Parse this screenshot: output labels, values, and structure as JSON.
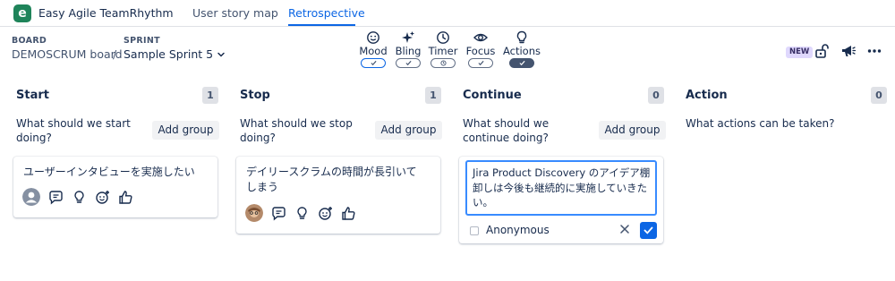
{
  "app": {
    "title": "Easy Agile TeamRhythm",
    "logo_letter": "e"
  },
  "tabs": [
    {
      "label": "User story map",
      "active": false
    },
    {
      "label": "Retrospective",
      "active": true
    }
  ],
  "header": {
    "board_label": "BOARD",
    "board_name": "DEMOSCRUM board",
    "separator": "/",
    "sprint_label": "SPRINT",
    "sprint_name": "Sample Sprint 5",
    "new_badge": "NEW"
  },
  "tools": [
    {
      "label": "Mood",
      "icon": "smile-icon",
      "enabled": true
    },
    {
      "label": "Bling",
      "icon": "sparkle-icon",
      "enabled": true
    },
    {
      "label": "Timer",
      "icon": "clock-icon",
      "enabled": true
    },
    {
      "label": "Focus",
      "icon": "eye-icon",
      "enabled": true
    },
    {
      "label": "Actions",
      "icon": "lightbulb-icon",
      "enabled": true
    }
  ],
  "columns": [
    {
      "title": "Start",
      "count": "1",
      "prompt": "What should we start doing?",
      "add_group": "Add group"
    },
    {
      "title": "Stop",
      "count": "1",
      "prompt": "What should we stop doing?",
      "add_group": "Add group"
    },
    {
      "title": "Continue",
      "count": "0",
      "prompt": "What should we continue doing?",
      "add_group": "Add group"
    },
    {
      "title": "Action",
      "count": "0",
      "prompt": "What actions can be taken?"
    }
  ],
  "cards": {
    "start": {
      "text": "ユーザーインタビューを実施したい",
      "avatar": "anonymous"
    },
    "stop": {
      "text": "デイリースクラムの時間が長引いてしまう",
      "avatar": "user-photo"
    }
  },
  "editor": {
    "value": "Jira Product Discovery のアイデア棚卸しは今後も継続的に実施していきたい。",
    "anonymous_label": "Anonymous",
    "anonymous_checked": false
  },
  "colors": {
    "accent": "#0c66e4",
    "logo": "#1f845a",
    "badge_bg": "#dfd8fd"
  }
}
